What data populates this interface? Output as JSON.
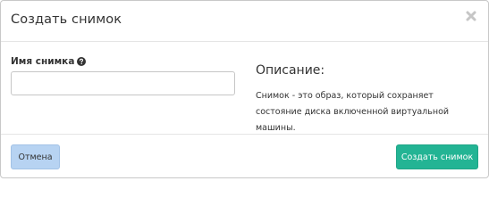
{
  "dialog": {
    "title": "Создать снимок",
    "close_icon": "close-icon"
  },
  "form": {
    "name_label": "Имя снимка",
    "help_icon": "question-circle-icon",
    "name_value": "",
    "name_placeholder": ""
  },
  "description": {
    "title": "Описание:",
    "text": "Снимок - это образ, который сохраняет состояние диска включенной виртуальной машины."
  },
  "footer": {
    "cancel_label": "Отмена",
    "create_label": "Создать снимок"
  },
  "colors": {
    "cancel_button": "#b7d3f2",
    "create_button": "#23b494"
  }
}
